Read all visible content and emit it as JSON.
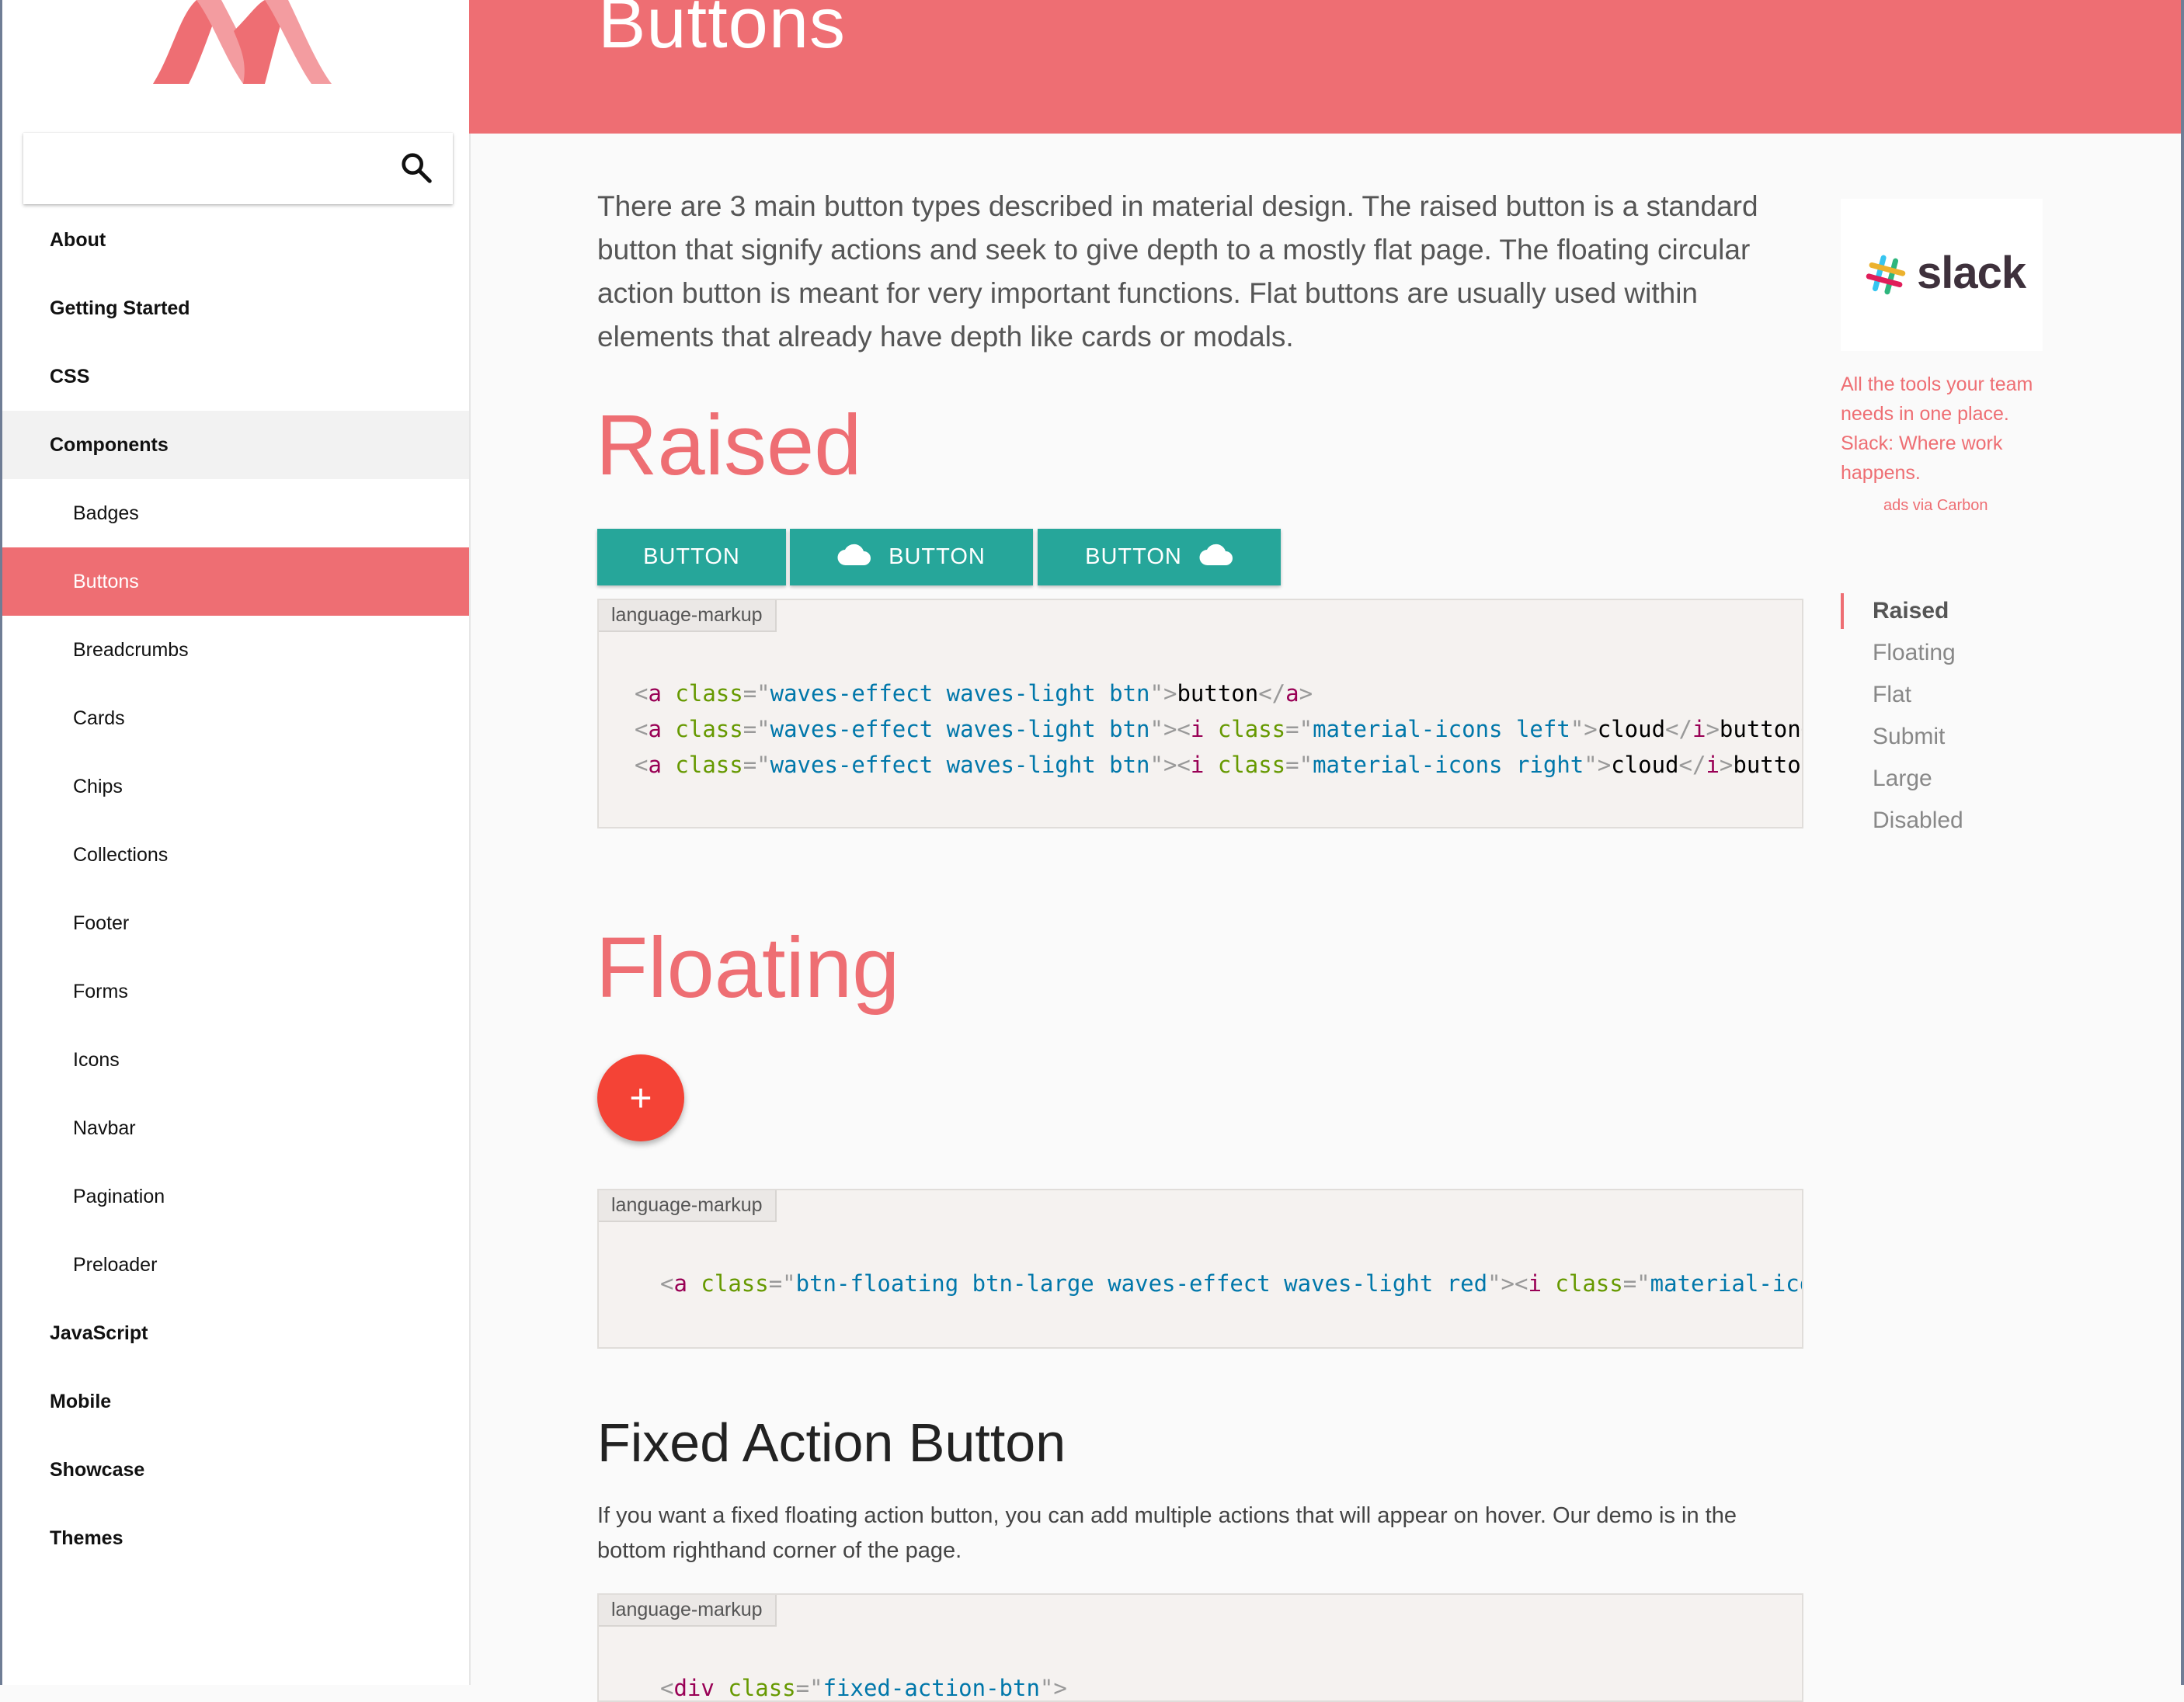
{
  "header": {
    "title": "Buttons"
  },
  "sidebar": {
    "search": {
      "placeholder": ""
    },
    "items": [
      {
        "label": "About",
        "level": "top"
      },
      {
        "label": "Getting Started",
        "level": "top"
      },
      {
        "label": "CSS",
        "level": "top"
      },
      {
        "label": "Components",
        "level": "top",
        "state": "open"
      },
      {
        "label": "Badges",
        "level": "sub"
      },
      {
        "label": "Buttons",
        "level": "sub",
        "state": "active"
      },
      {
        "label": "Breadcrumbs",
        "level": "sub"
      },
      {
        "label": "Cards",
        "level": "sub"
      },
      {
        "label": "Chips",
        "level": "sub"
      },
      {
        "label": "Collections",
        "level": "sub"
      },
      {
        "label": "Footer",
        "level": "sub"
      },
      {
        "label": "Forms",
        "level": "sub"
      },
      {
        "label": "Icons",
        "level": "sub"
      },
      {
        "label": "Navbar",
        "level": "sub"
      },
      {
        "label": "Pagination",
        "level": "sub"
      },
      {
        "label": "Preloader",
        "level": "sub"
      },
      {
        "label": "JavaScript",
        "level": "top"
      },
      {
        "label": "Mobile",
        "level": "top"
      },
      {
        "label": "Showcase",
        "level": "top"
      },
      {
        "label": "Themes",
        "level": "top"
      }
    ]
  },
  "main": {
    "intro": "There are 3 main button types described in material design. The raised button is a standard button that signify actions and seek to give depth to a mostly flat page. The floating circular action button is meant for very important functions. Flat buttons are usually used within elements that already have depth like cards or modals.",
    "raised": {
      "heading": "Raised",
      "buttons": [
        {
          "label": "BUTTON",
          "icon": "none"
        },
        {
          "label": "BUTTON",
          "icon": "cloud-left"
        },
        {
          "label": "BUTTON",
          "icon": "cloud-right"
        }
      ],
      "code_lang": "language-markup"
    },
    "floating": {
      "heading": "Floating",
      "fab_icon": "+",
      "code_lang": "language-markup"
    },
    "fixed_action": {
      "heading": "Fixed Action Button",
      "description": "If you want a fixed floating action button, you can add multiple actions that will appear on hover. Our demo is in the bottom righthand corner of the page.",
      "code_lang": "language-markup"
    }
  },
  "ad": {
    "brand": "slack",
    "text": "All the tools your team needs in one place. Slack: Where work happens.",
    "via": "ads via Carbon"
  },
  "toc": {
    "items": [
      "Raised",
      "Floating",
      "Flat",
      "Submit",
      "Large",
      "Disabled"
    ],
    "active": "Raised"
  },
  "colors": {
    "accent": "#ee6e73",
    "teal": "#26a69a",
    "red": "#f44336"
  }
}
